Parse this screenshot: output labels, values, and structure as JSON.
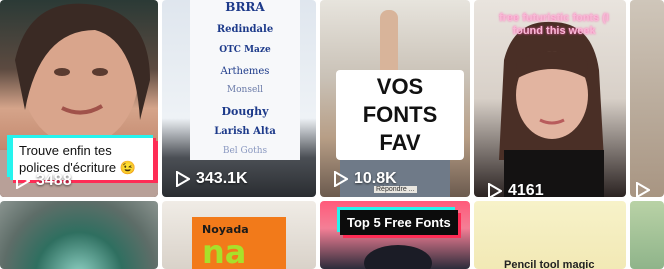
{
  "tiles": [
    {
      "id": "tile-1",
      "caption": "Trouve enfin tes polices d'écriture 😉",
      "views": "3488"
    },
    {
      "id": "tile-2",
      "font_samples": [
        "BRRA",
        "Redindale",
        "OTC Maze",
        "Arthemes",
        "Monsell",
        "Doughy",
        "Larish Alta",
        "Bel Goths"
      ],
      "views": "343.1K"
    },
    {
      "id": "tile-3",
      "caption": "VOS FONTS FAV",
      "views": "10.8K",
      "small_text": "Répondre ..."
    },
    {
      "id": "tile-4",
      "caption": "free futuristic fonts (I found this week",
      "views": "4161"
    },
    {
      "id": "tile-5"
    },
    {
      "id": "tile-6"
    },
    {
      "id": "tile-7",
      "sticker_text": "Noyada",
      "sticker_big": "na"
    },
    {
      "id": "tile-8",
      "caption": "Top 5 Free Fonts"
    },
    {
      "id": "tile-9",
      "caption": "Pencil tool magic"
    },
    {
      "id": "tile-10"
    }
  ],
  "colors": {
    "accent_cyan": "#25f4ee",
    "accent_pink": "#fe2c55"
  },
  "icons": {
    "play": "play-icon"
  }
}
